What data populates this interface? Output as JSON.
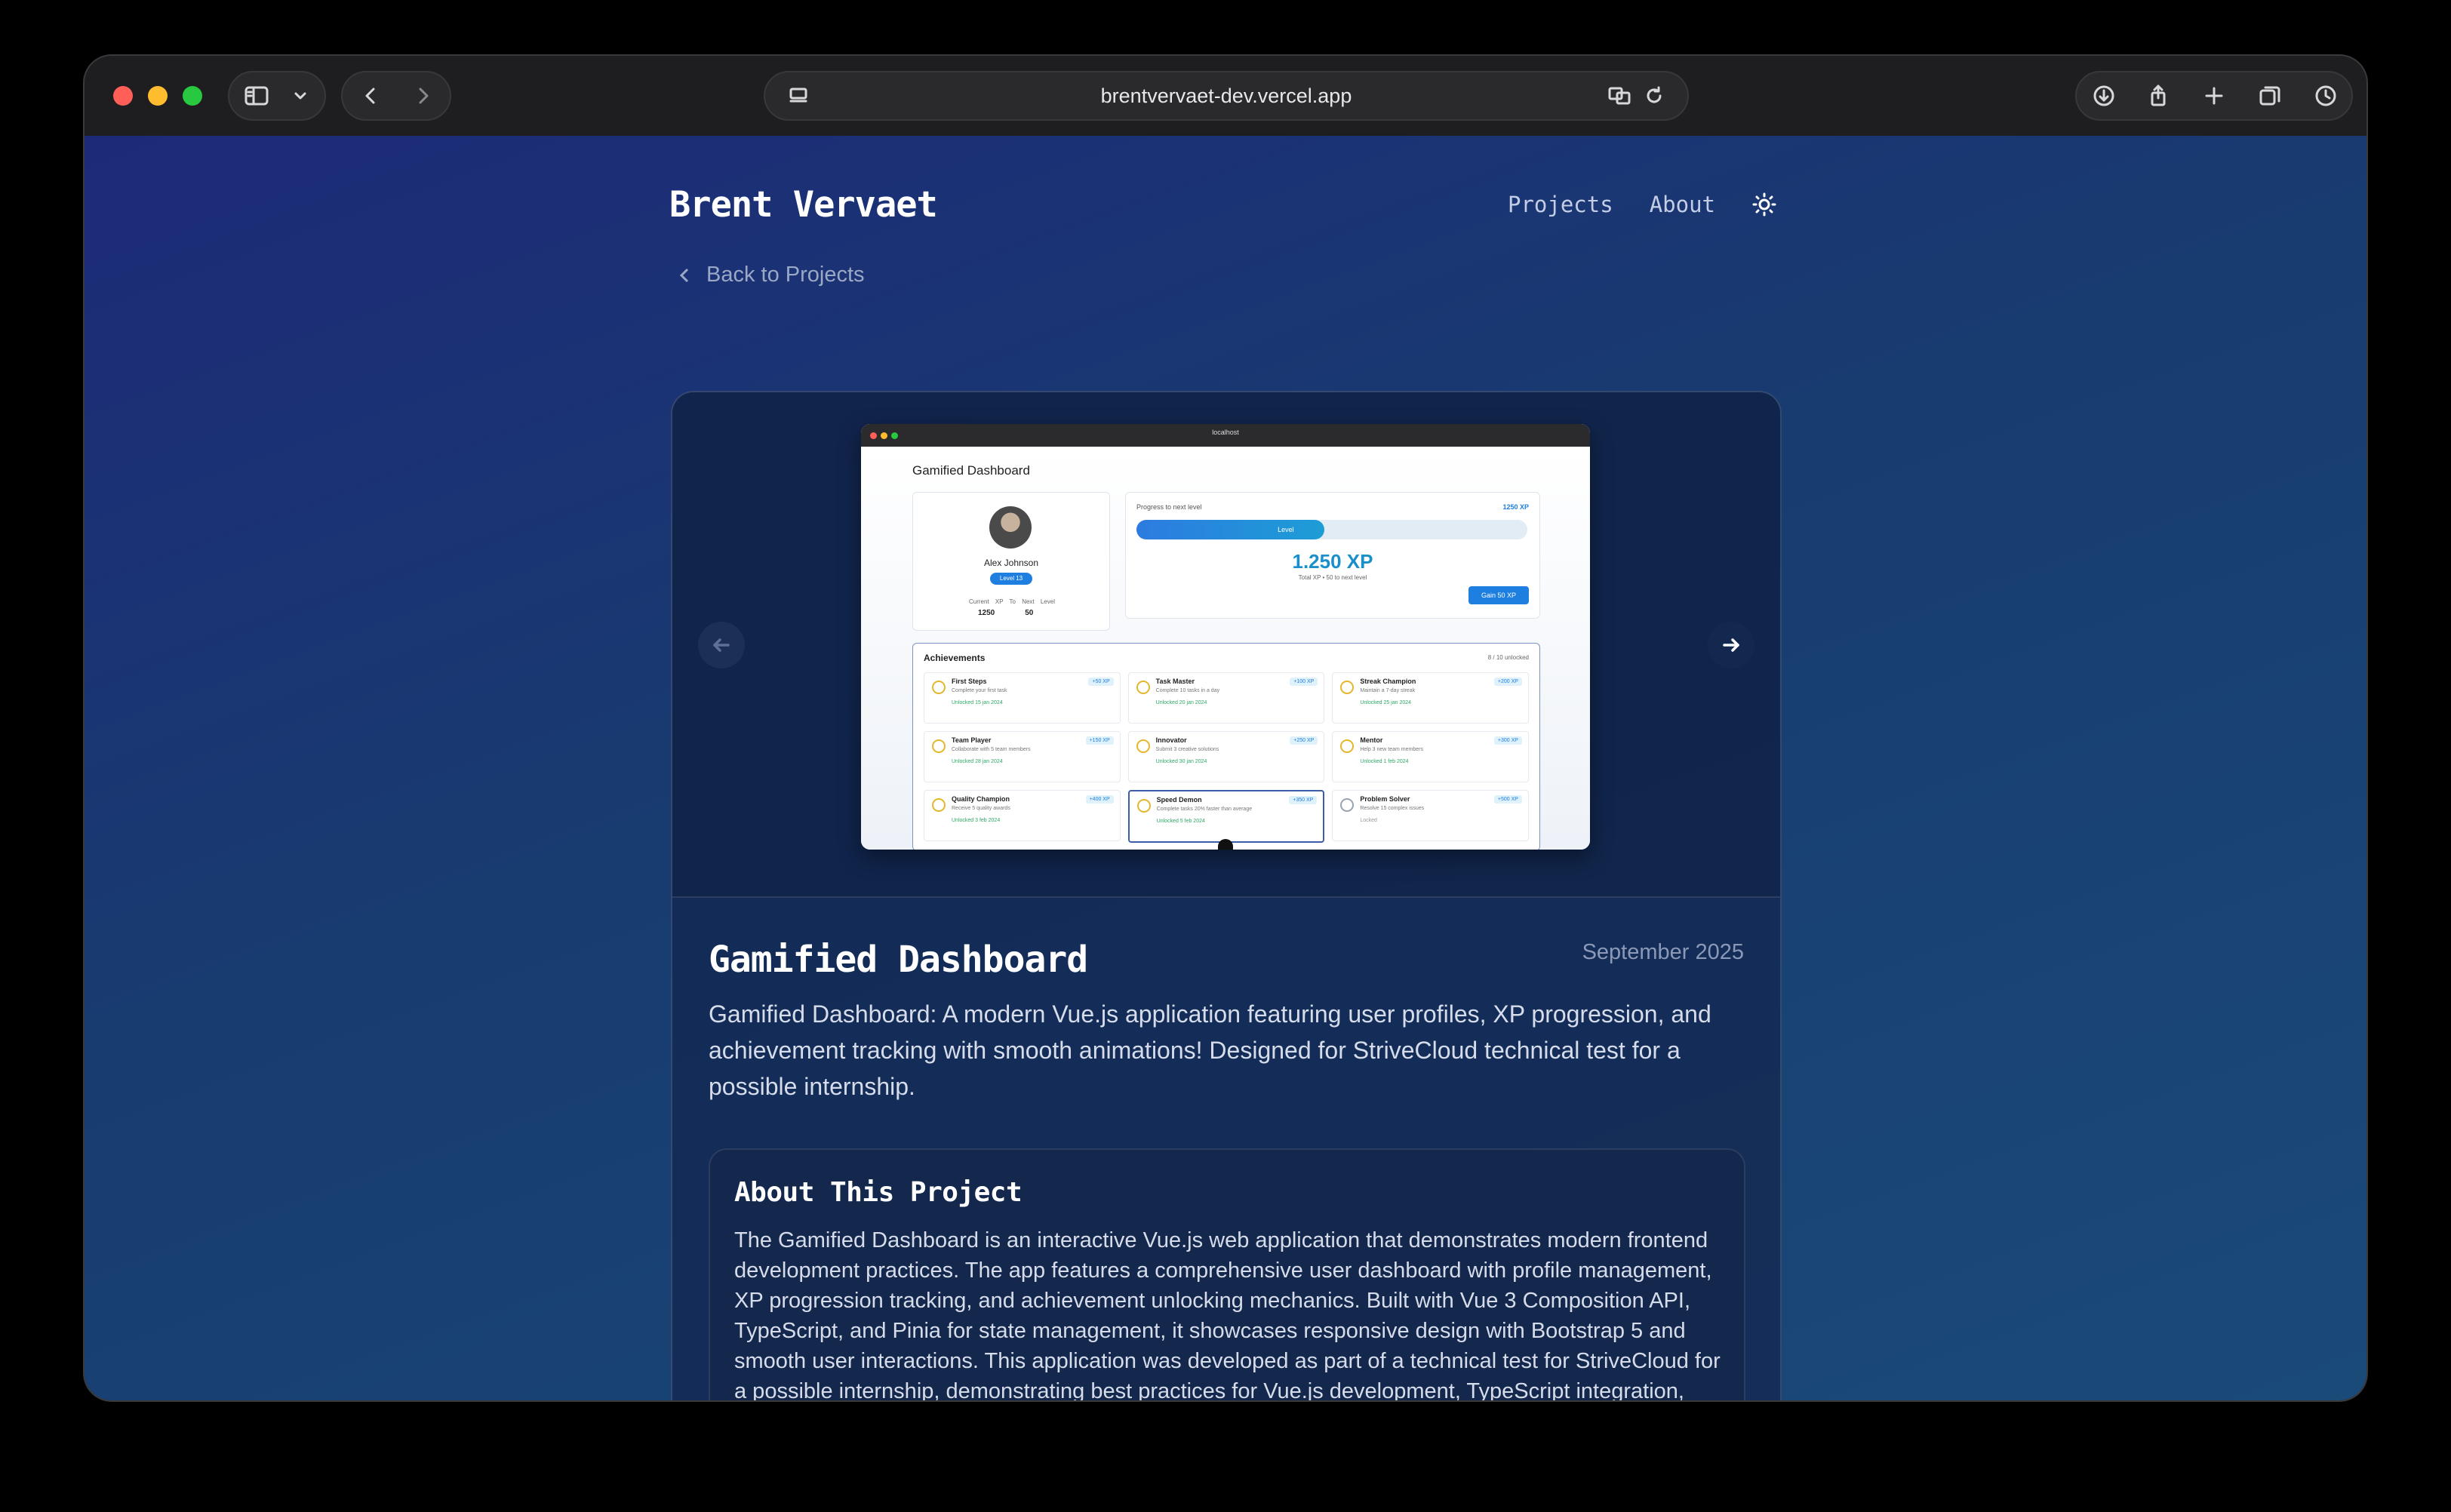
{
  "browser": {
    "url": "brentvervaet-dev.vercel.app"
  },
  "site": {
    "brand": "Brent Vervaet",
    "nav": [
      "Projects",
      "About"
    ]
  },
  "back_link": "Back to Projects",
  "screenshot": {
    "url": "localhost",
    "title": "Gamified Dashboard",
    "profile": {
      "name": "Alex Johnson",
      "level": "Level 13",
      "current_xp_label": "Current XP",
      "next_level_label": "To Next Level",
      "current_xp": "1250",
      "next_level": "50"
    },
    "progress": {
      "label": "Progress to next level",
      "xp_badge": "1250 XP",
      "fill_fraction": 0.48,
      "bar_label": "Level",
      "big": "1.250 XP",
      "sub": "Total XP • 50 to next level",
      "gain_button": "Gain 50 XP"
    },
    "achievements": {
      "title": "Achievements",
      "count": "8 / 10 unlocked",
      "items": [
        {
          "title": "First Steps",
          "desc": "Complete your first task",
          "date": "Unlocked 15 jan 2024",
          "xp": "+50 XP"
        },
        {
          "title": "Task Master",
          "desc": "Complete 10 tasks in a day",
          "date": "Unlocked 20 jan 2024",
          "xp": "+100 XP"
        },
        {
          "title": "Streak Champion",
          "desc": "Maintain a 7-day streak",
          "date": "Unlocked 25 jan 2024",
          "xp": "+200 XP"
        },
        {
          "title": "Team Player",
          "desc": "Collaborate with 5 team members",
          "date": "Unlocked 28 jan 2024",
          "xp": "+150 XP"
        },
        {
          "title": "Innovator",
          "desc": "Submit 3 creative solutions",
          "date": "Unlocked 30 jan 2024",
          "xp": "+250 XP"
        },
        {
          "title": "Mentor",
          "desc": "Help 3 new team members",
          "date": "Unlocked 1 feb 2024",
          "xp": "+300 XP"
        },
        {
          "title": "Quality Champion",
          "desc": "Receive 5 quality awards",
          "date": "Unlocked 3 feb 2024",
          "xp": "+400 XP"
        },
        {
          "title": "Speed Demon",
          "desc": "Complete tasks 20% faster than average",
          "date": "Unlocked 5 feb 2024",
          "xp": "+350 XP"
        },
        {
          "title": "Problem Solver",
          "desc": "Resolve 15 complex issues",
          "date": "Locked",
          "xp": "+500 XP"
        }
      ]
    }
  },
  "project": {
    "title": "Gamified Dashboard",
    "date": "September 2025",
    "description": "Gamified Dashboard: A modern Vue.js application featuring user profiles, XP progression, and achievement tracking with smooth animations! Designed for StriveCloud technical test for a possible internship.",
    "about_title": "About This Project",
    "about_text": "The Gamified Dashboard is an interactive Vue.js web application that demonstrates modern frontend development practices. The app features a comprehensive user dashboard with profile management, XP progression tracking, and achievement unlocking mechanics. Built with Vue 3 Composition API, TypeScript, and Pinia for state management, it showcases responsive design with Bootstrap 5 and smooth user interactions. This application was developed as part of a technical test for StriveCloud for a possible internship, demonstrating best practices for Vue.js development, TypeScript integration, state management patterns, component architecture, and modern frontend tooling with Vite."
  }
}
